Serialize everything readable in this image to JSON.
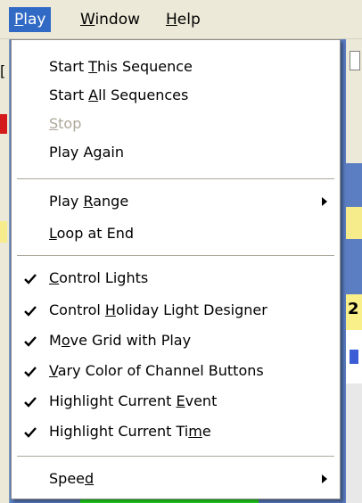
{
  "menubar": {
    "items": [
      {
        "pre": "",
        "u": "P",
        "post": "lay"
      },
      {
        "pre": "",
        "u": "W",
        "post": "indow"
      },
      {
        "pre": "",
        "u": "H",
        "post": "elp"
      }
    ]
  },
  "dropdown": {
    "items": [
      {
        "pre": "Start ",
        "u": "T",
        "post": "his Sequence"
      },
      {
        "pre": "Start ",
        "u": "A",
        "post": "ll Sequences"
      },
      {
        "pre": "",
        "u": "S",
        "post": "top"
      },
      {
        "pre": "Play A",
        "u": "g",
        "post": "ain"
      },
      {
        "pre": "Play ",
        "u": "R",
        "post": "ange"
      },
      {
        "pre": "",
        "u": "L",
        "post": "oop at End"
      },
      {
        "pre": "",
        "u": "C",
        "post": "ontrol Lights"
      },
      {
        "pre": "Control ",
        "u": "H",
        "post": "oliday Light Designer"
      },
      {
        "pre": "M",
        "u": "o",
        "post": "ve Grid with Play"
      },
      {
        "pre": "",
        "u": "V",
        "post": "ary Color of Channel Buttons"
      },
      {
        "pre": "Highlight Current ",
        "u": "E",
        "post": "vent"
      },
      {
        "pre": "Highlight Current Ti",
        "u": "m",
        "post": "e"
      },
      {
        "pre": "Spee",
        "u": "d",
        "post": ""
      }
    ]
  },
  "background": {
    "fragments": [
      "[",
      "2"
    ]
  },
  "colors": {
    "menu_highlight": "#316ac5",
    "disabled_text": "#aca899",
    "menu_bg": "#ffffff"
  }
}
